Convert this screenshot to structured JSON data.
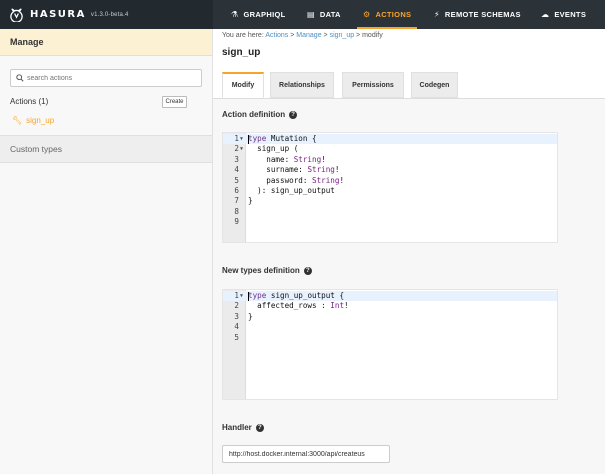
{
  "brand": {
    "name": "HASURA",
    "version": "v1.3.0-beta.4"
  },
  "nav": [
    {
      "label": "GRAPHIQL",
      "icon": "flask-icon"
    },
    {
      "label": "DATA",
      "icon": "database-icon"
    },
    {
      "label": "ACTIONS",
      "icon": "cogs-icon",
      "active": true
    },
    {
      "label": "REMOTE SCHEMAS",
      "icon": "plug-icon"
    },
    {
      "label": "EVENTS",
      "icon": "cloud-icon"
    }
  ],
  "sidebar": {
    "manage_label": "Manage",
    "search_placeholder": "search actions",
    "actions_header": "Actions (1)",
    "create_label": "Create",
    "actions": [
      "sign_up"
    ],
    "custom_types_label": "Custom types"
  },
  "breadcrumb": {
    "prefix": "You are here:",
    "items": [
      "Actions",
      "Manage",
      "sign_up",
      "modify"
    ]
  },
  "page_title": "sign_up",
  "tabs": [
    "Modify",
    "Relationships",
    "Permissions",
    "Codegen"
  ],
  "action_definition": {
    "title": "Action definition",
    "lines": [
      "type Mutation {",
      "  sign_up (",
      "    name: String!",
      "    surname: String!",
      "    password: String!",
      "  ): sign_up_output",
      "}",
      "",
      ""
    ]
  },
  "new_types_definition": {
    "title": "New types definition",
    "lines": [
      "type sign_up_output {",
      "  affected_rows : Int!",
      "}",
      "",
      ""
    ]
  },
  "handler": {
    "title": "Handler",
    "value": "http://host.docker.internal:3000/api/createus"
  },
  "colors": {
    "accent": "#f8a42a",
    "nav_bg": "#2b3238",
    "manage_bg": "#fdf1d4"
  }
}
